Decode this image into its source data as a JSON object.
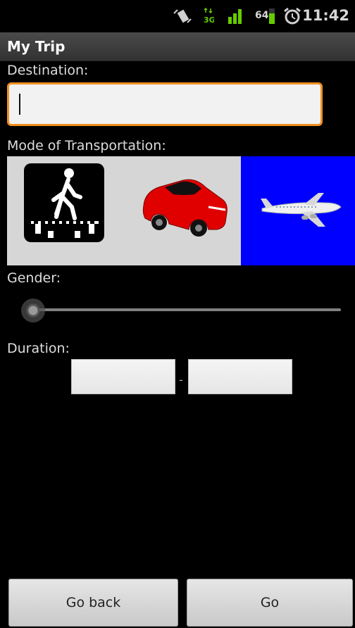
{
  "status_bar": {
    "time": "11:42",
    "battery_level": "64",
    "icons": [
      "vibrate-icon",
      "data-3g-icon",
      "signal-icon",
      "battery-icon",
      "alarm-icon"
    ]
  },
  "title_bar": {
    "title": "My Trip"
  },
  "form": {
    "destination": {
      "label": "Destination:",
      "value": "",
      "placeholder": ""
    },
    "transport": {
      "label": "Mode of Transportation:",
      "options": [
        "walk",
        "car",
        "plane"
      ],
      "selected": "plane"
    },
    "gender": {
      "label": "Gender:",
      "slider_value": 0.0
    },
    "duration": {
      "label": "Duration:",
      "separator": "-",
      "from": "",
      "to": ""
    }
  },
  "buttons": {
    "back": "Go back",
    "go": "Go"
  }
}
